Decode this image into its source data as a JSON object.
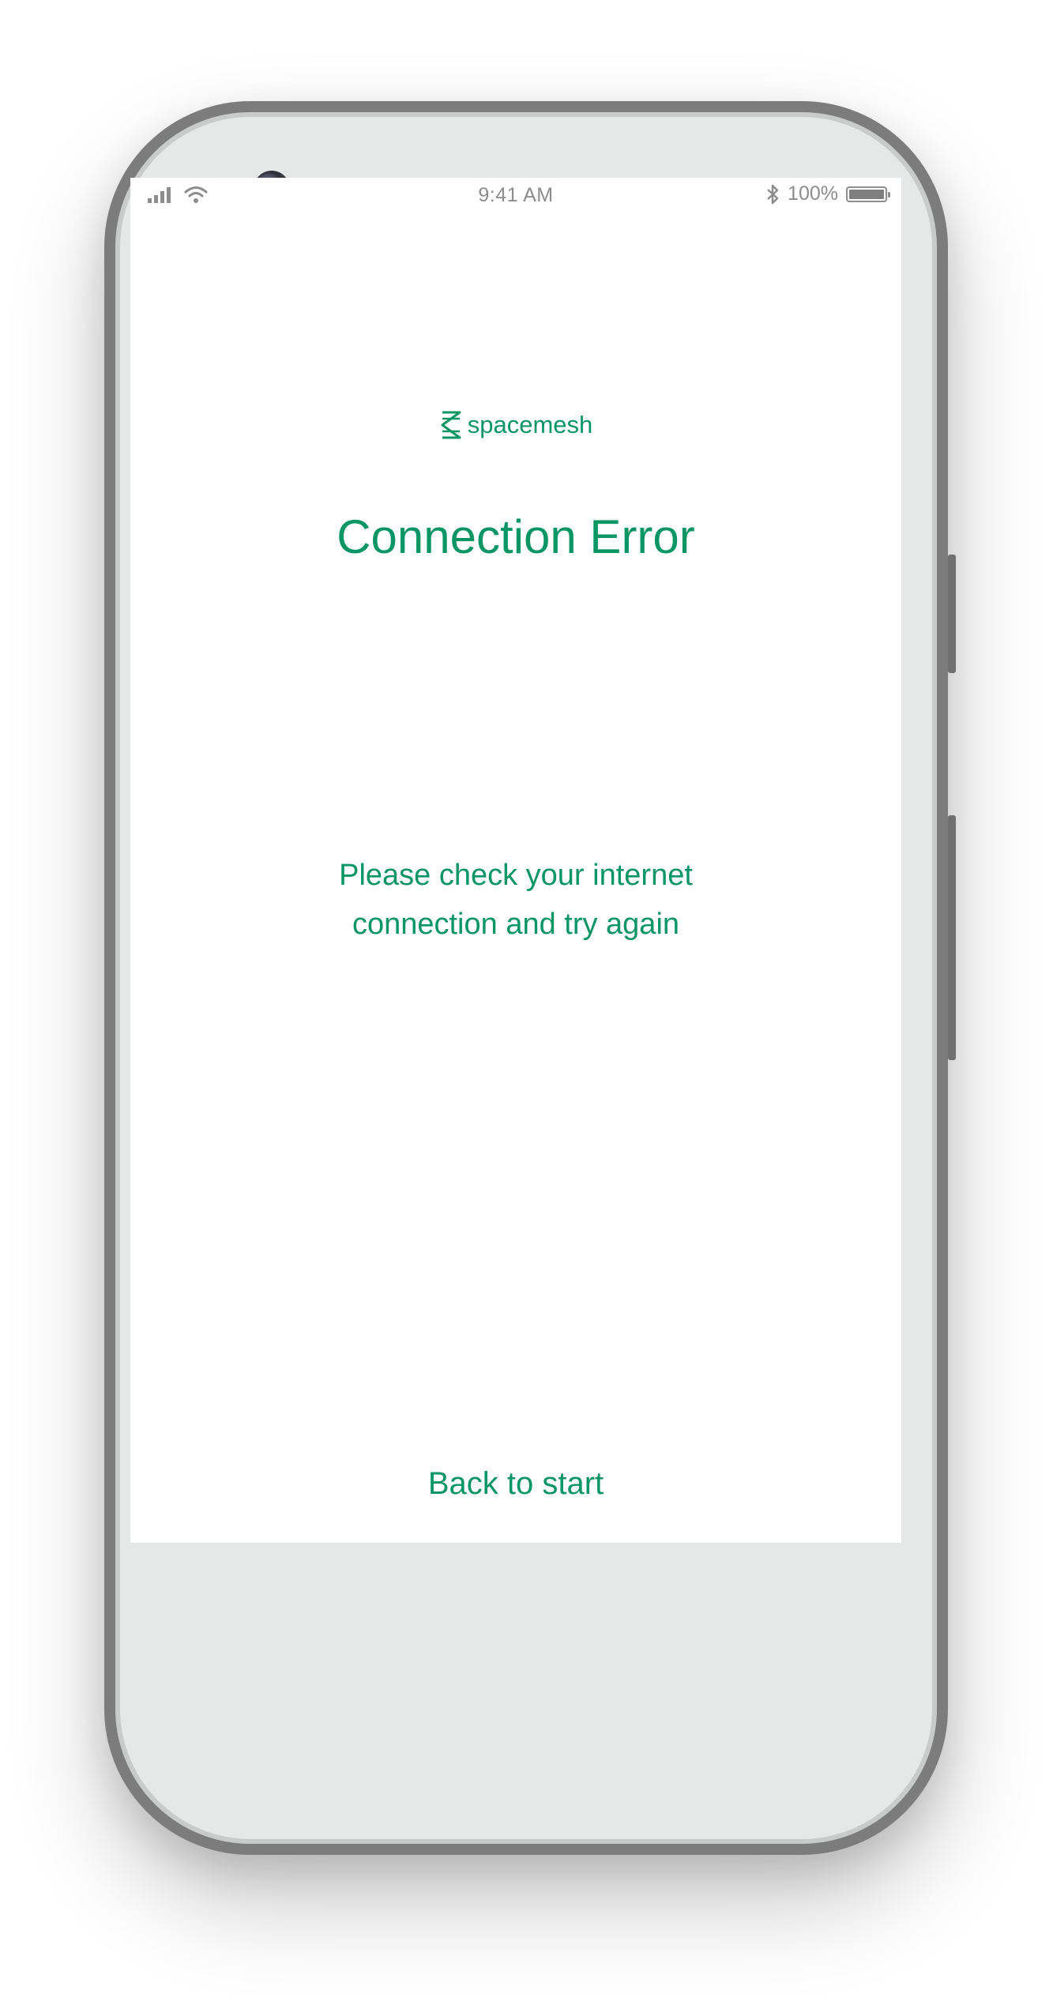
{
  "status_bar": {
    "time": "9:41 AM",
    "battery_percent": "100%",
    "battery_level": 1.0,
    "icons": [
      "signal-icon",
      "wifi-icon",
      "bluetooth-icon",
      "battery-icon"
    ]
  },
  "logo": {
    "text": "spacemesh",
    "icon": "spacemesh-logo-icon"
  },
  "title": "Connection Error",
  "message": {
    "line1": "Please check your internet",
    "line2": "connection and try again"
  },
  "actions": {
    "back_label": "Back to start"
  },
  "colors": {
    "accent": "#0a9565",
    "status_text": "#8d8d8d",
    "phone_body": "#e6e7e7",
    "phone_frame": "#7c7c7c"
  }
}
